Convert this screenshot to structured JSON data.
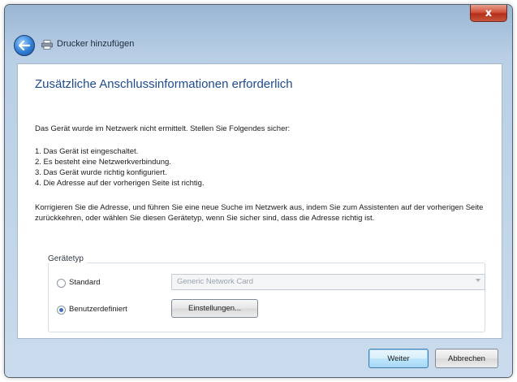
{
  "window": {
    "title": "Drucker hinzufügen",
    "close_glyph": "x"
  },
  "heading": "Zusätzliche Anschlussinformationen erforderlich",
  "intro": "Das Gerät wurde im Netzwerk nicht ermittelt. Stellen Sie Folgendes sicher:",
  "checklist": [
    "1. Das Gerät ist eingeschaltet.",
    "2. Es besteht eine Netzwerkverbindung.",
    "3. Das Gerät wurde richtig konfiguriert.",
    "4. Die Adresse auf der vorherigen Seite ist richtig."
  ],
  "paragraph": "Korrigieren Sie die Adresse, und führen Sie eine neue Suche im Netzwerk aus, indem Sie zum Assistenten auf der vorherigen Seite zurückkehren, oder wählen Sie diesen Gerätetyp, wenn Sie sicher sind, dass die Adresse richtig ist.",
  "device_type": {
    "legend": "Gerätetyp",
    "option_standard": "Standard",
    "option_custom": "Benutzerdefiniert",
    "selected": "Benutzerdefiniert",
    "standard_select_value": "Generic Network Card",
    "settings_button": "Einstellungen..."
  },
  "footer": {
    "next_button": "Weiter",
    "cancel_button": "Abbrechen"
  },
  "icons": {
    "back": "back-arrow-icon",
    "printer": "printer-icon",
    "close": "close-icon",
    "dropdown": "chevron-down-icon"
  }
}
